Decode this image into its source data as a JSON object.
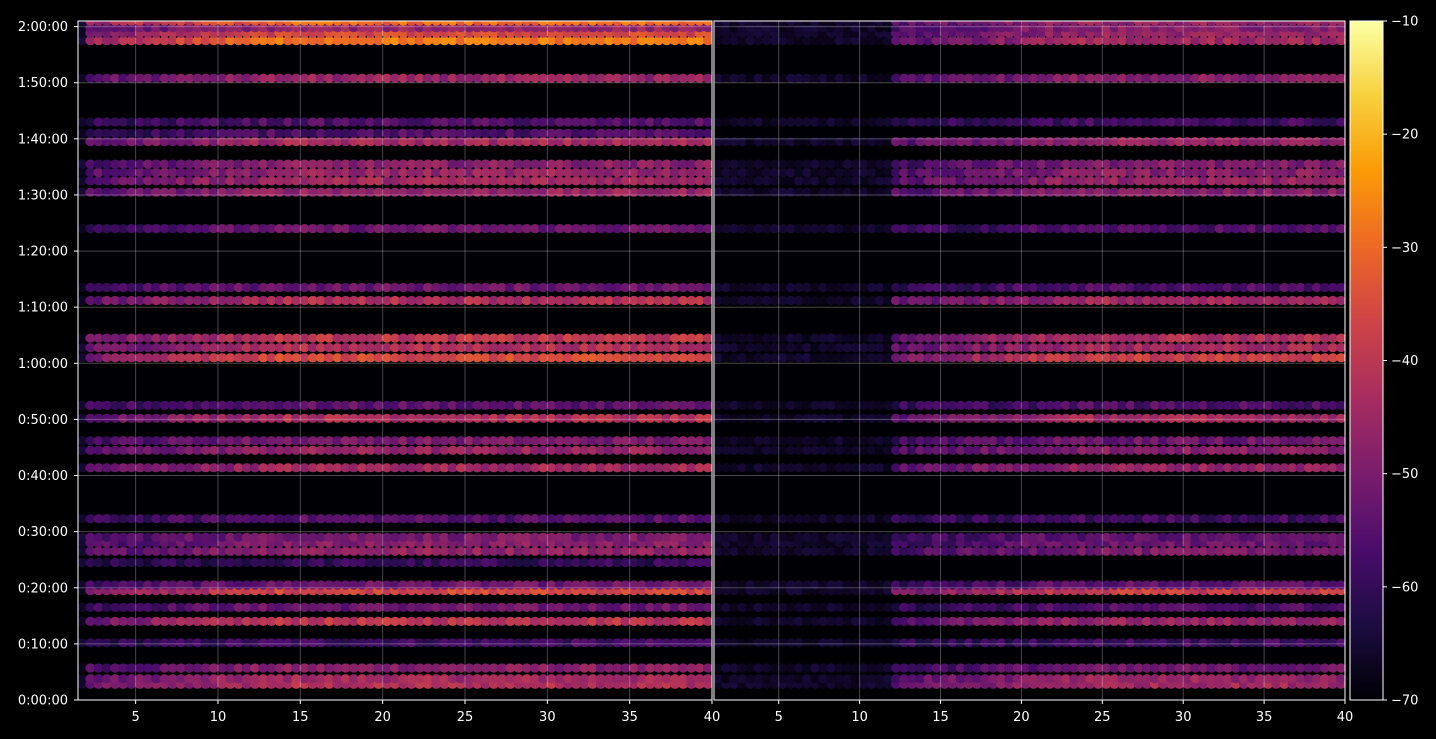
{
  "chart_data": [
    {
      "type": "heatmap",
      "panel": "left",
      "x_ticks": [
        "5",
        "10",
        "15",
        "20",
        "25",
        "30",
        "35",
        "40"
      ],
      "x_tick_values": [
        5,
        10,
        15,
        20,
        25,
        30,
        35,
        40
      ],
      "xlim": [
        1.5,
        40
      ],
      "y_ticks": [
        "0:00:00",
        "0:10:00",
        "0:20:00",
        "0:30:00",
        "0:40:00",
        "0:50:00",
        "1:00:00",
        "1:10:00",
        "1:20:00",
        "1:30:00",
        "1:40:00",
        "1:50:00",
        "2:00:00"
      ],
      "y_tick_values_min": [
        0,
        10,
        20,
        30,
        40,
        50,
        60,
        70,
        80,
        90,
        100,
        110,
        120
      ],
      "ylim_min": [
        0,
        121
      ],
      "grid": true,
      "active_from_x": 2,
      "bands": [
        {
          "t": 2.8,
          "level": -42
        },
        {
          "t": 3.8,
          "level": -44
        },
        {
          "t": 5.7,
          "level": -48
        },
        {
          "t": 10.2,
          "level": -58
        },
        {
          "t": 14.0,
          "level": -40
        },
        {
          "t": 16.5,
          "level": -52
        },
        {
          "t": 19.5,
          "level": -36
        },
        {
          "t": 20.5,
          "level": -52
        },
        {
          "t": 24.5,
          "level": -60
        },
        {
          "t": 26.5,
          "level": -46
        },
        {
          "t": 28.0,
          "level": -48
        },
        {
          "t": 29.0,
          "level": -50
        },
        {
          "t": 32.3,
          "level": -55
        },
        {
          "t": 41.4,
          "level": -44
        },
        {
          "t": 44.5,
          "level": -46
        },
        {
          "t": 46.2,
          "level": -50
        },
        {
          "t": 50.2,
          "level": -42
        },
        {
          "t": 52.5,
          "level": -54
        },
        {
          "t": 61.0,
          "level": -36
        },
        {
          "t": 62.8,
          "level": -42
        },
        {
          "t": 64.5,
          "level": -40
        },
        {
          "t": 71.2,
          "level": -42
        },
        {
          "t": 73.5,
          "level": -52
        },
        {
          "t": 84.0,
          "level": -52
        },
        {
          "t": 90.5,
          "level": -46
        },
        {
          "t": 92.5,
          "level": -44
        },
        {
          "t": 94.0,
          "level": -46
        },
        {
          "t": 95.5,
          "level": -48
        },
        {
          "t": 99.5,
          "level": -44
        },
        {
          "t": 101.0,
          "level": -56
        },
        {
          "t": 103.0,
          "level": -56
        },
        {
          "t": 110.8,
          "level": -46
        },
        {
          "t": 117.5,
          "level": -28
        },
        {
          "t": 118.8,
          "level": -36
        },
        {
          "t": 119.8,
          "level": -46
        },
        {
          "t": 121.0,
          "level": -30
        }
      ]
    },
    {
      "type": "heatmap",
      "panel": "right",
      "x_ticks": [
        "5",
        "10",
        "15",
        "20",
        "25",
        "30",
        "35",
        "40"
      ],
      "x_tick_values": [
        5,
        10,
        15,
        20,
        25,
        30,
        35,
        40
      ],
      "xlim": [
        1,
        40
      ],
      "y_ticks": [],
      "ylim_min": [
        0,
        121
      ],
      "grid": true,
      "active_from_x": 12,
      "bands": [
        {
          "t": 2.8,
          "level": -44
        },
        {
          "t": 3.8,
          "level": -46
        },
        {
          "t": 5.7,
          "level": -52
        },
        {
          "t": 10.2,
          "level": -58
        },
        {
          "t": 14.0,
          "level": -46
        },
        {
          "t": 16.5,
          "level": -56
        },
        {
          "t": 19.5,
          "level": -38
        },
        {
          "t": 20.5,
          "level": -54
        },
        {
          "t": 26.5,
          "level": -50
        },
        {
          "t": 28.0,
          "level": -52
        },
        {
          "t": 29.0,
          "level": -54
        },
        {
          "t": 32.3,
          "level": -58
        },
        {
          "t": 41.4,
          "level": -46
        },
        {
          "t": 44.5,
          "level": -48
        },
        {
          "t": 46.2,
          "level": -52
        },
        {
          "t": 50.2,
          "level": -44
        },
        {
          "t": 52.5,
          "level": -56
        },
        {
          "t": 61.0,
          "level": -38
        },
        {
          "t": 62.8,
          "level": -44
        },
        {
          "t": 64.5,
          "level": -42
        },
        {
          "t": 71.2,
          "level": -44
        },
        {
          "t": 73.5,
          "level": -56
        },
        {
          "t": 84.0,
          "level": -56
        },
        {
          "t": 90.5,
          "level": -48
        },
        {
          "t": 92.5,
          "level": -46
        },
        {
          "t": 94.0,
          "level": -48
        },
        {
          "t": 95.5,
          "level": -50
        },
        {
          "t": 99.5,
          "level": -46
        },
        {
          "t": 103.0,
          "level": -58
        },
        {
          "t": 110.8,
          "level": -48
        },
        {
          "t": 117.5,
          "level": -44
        },
        {
          "t": 118.8,
          "level": -46
        },
        {
          "t": 119.8,
          "level": -48
        },
        {
          "t": 121.0,
          "level": -46
        }
      ]
    },
    {
      "type": "colorbar",
      "colormap": "inferno",
      "range": [
        -70,
        -10
      ],
      "ticks": [
        "−70",
        "−60",
        "−50",
        "−40",
        "−30",
        "−20",
        "−10"
      ],
      "tick_values": [
        -70,
        -60,
        -50,
        -40,
        -30,
        -20,
        -10
      ]
    }
  ],
  "colors": {
    "background": "#000000",
    "plot_background": "#000004",
    "text": "#ffffff",
    "inferno_stops": [
      "#000004",
      "#1b0c41",
      "#4a0c6b",
      "#781c6d",
      "#a52c60",
      "#cf4446",
      "#ed6925",
      "#fb9b06",
      "#f7d13d",
      "#fcffa4"
    ]
  }
}
